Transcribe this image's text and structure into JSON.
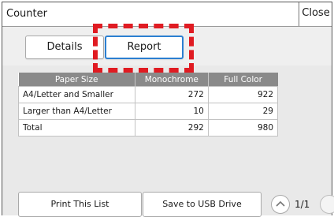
{
  "window": {
    "title": "Counter",
    "close_label": "Close"
  },
  "tabs": [
    {
      "label": "Details",
      "selected": false
    },
    {
      "label": "Report",
      "selected": true
    }
  ],
  "table": {
    "headers": [
      "Paper Size",
      "Monochrome",
      "Full Color"
    ],
    "rows": [
      [
        "A4/Letter and Smaller",
        "272",
        "922"
      ],
      [
        "Larger than A4/Letter",
        "10",
        "29"
      ],
      [
        "Total",
        "292",
        "980"
      ]
    ]
  },
  "buttons": {
    "print_label": "Print This List",
    "usb_label": "Save to USB Drive"
  },
  "pagination": {
    "indicator": "1/1"
  },
  "colors": {
    "accent": "#2b7fd1",
    "highlight": "#e01b22",
    "header_bg": "#8a8a8a"
  }
}
